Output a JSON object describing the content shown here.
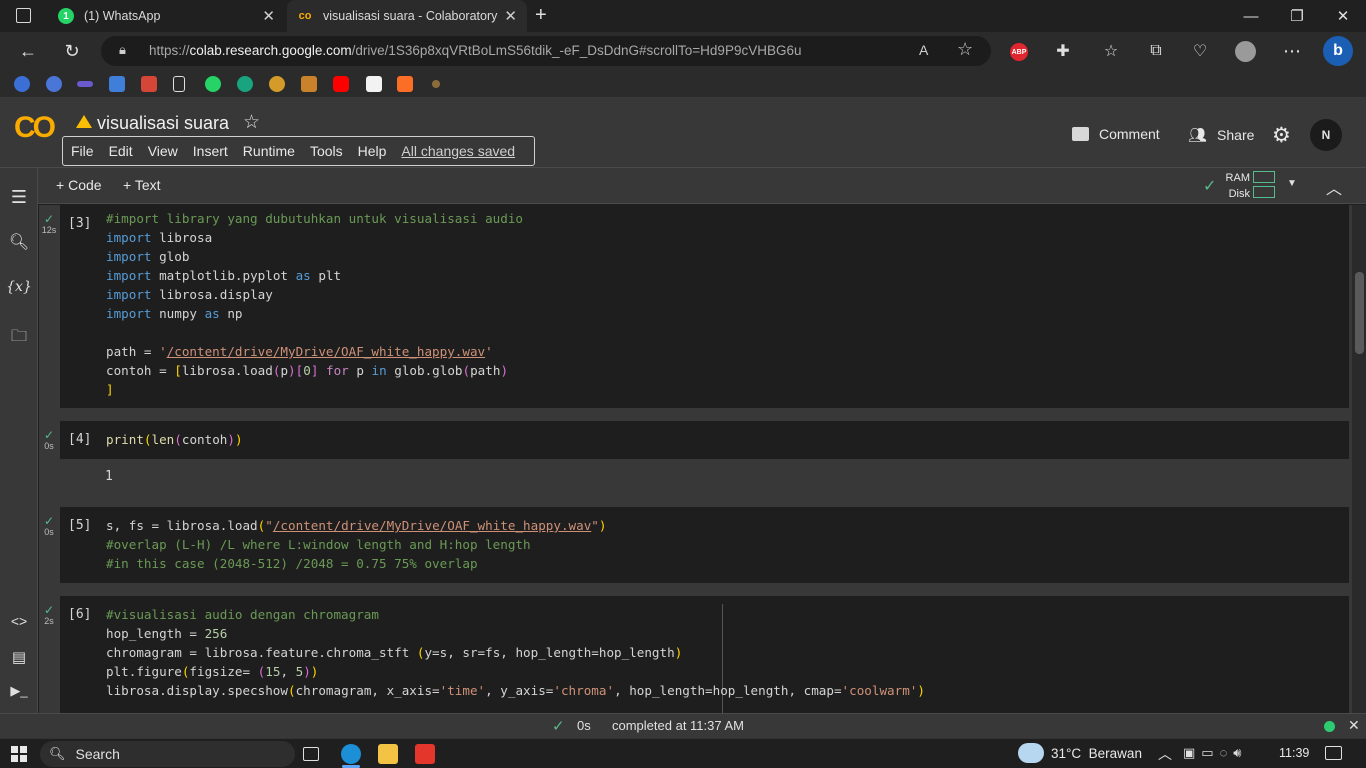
{
  "browser": {
    "tabs": [
      {
        "title": "(1) WhatsApp"
      },
      {
        "title": "visualisasi suara - Colaboratory"
      }
    ],
    "url_prefix": "https://",
    "url_host": "colab.research.google.com",
    "url_path": "/drive/1S36p8xqVRtBoLmS56tdik_-eF_DsDdnG#scrollTo=Hd9P9cVHBG6u",
    "read_aloud_label": "A",
    "abp_label": "ABP"
  },
  "colab": {
    "logo": "CO",
    "notebook_title": "visualisasi suara",
    "menu": [
      "File",
      "Edit",
      "View",
      "Insert",
      "Runtime",
      "Tools",
      "Help"
    ],
    "save_status": "All changes saved",
    "comment_label": "Comment",
    "share_label": "Share",
    "avatar_initial": "N",
    "add_code_label": "Code",
    "add_text_label": "Text",
    "ram_label": "RAM",
    "disk_label": "Disk"
  },
  "cells": [
    {
      "number": "[3]",
      "time": "12s"
    },
    {
      "number": "[4]",
      "time": "0s",
      "output": "1"
    },
    {
      "number": "[5]",
      "time": "0s"
    },
    {
      "number": "[6]",
      "time": "2s"
    }
  ],
  "status": {
    "duration": "0s",
    "message": "completed at 11:37 AM"
  },
  "taskbar": {
    "search_label": "Search",
    "weather": "31°C  Berawan",
    "time": "11:39"
  },
  "colors": {
    "accent_orange": "#f9ab00",
    "check_green": "#57bb8a"
  }
}
